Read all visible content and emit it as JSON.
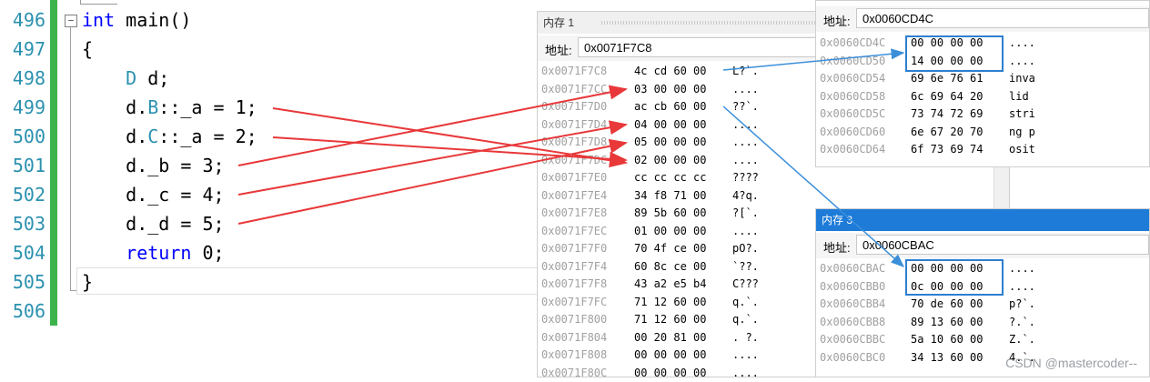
{
  "editor": {
    "lines": [
      {
        "num": "496",
        "tokens": [
          {
            "t": "int",
            "c": "kw"
          },
          {
            "t": " main()",
            "c": ""
          }
        ]
      },
      {
        "num": "497",
        "tokens": [
          {
            "t": "{",
            "c": ""
          }
        ]
      },
      {
        "num": "498",
        "tokens": [
          {
            "t": "    D",
            "c": "ty"
          },
          {
            "t": " d;",
            "c": ""
          }
        ]
      },
      {
        "num": "499",
        "tokens": [
          {
            "t": "    d.",
            "c": ""
          },
          {
            "t": "B",
            "c": "ty"
          },
          {
            "t": "::_a = 1;",
            "c": ""
          }
        ]
      },
      {
        "num": "500",
        "tokens": [
          {
            "t": "    d.",
            "c": ""
          },
          {
            "t": "C",
            "c": "ty"
          },
          {
            "t": "::_a = 2;",
            "c": ""
          }
        ]
      },
      {
        "num": "501",
        "tokens": [
          {
            "t": "    d._b = 3;",
            "c": ""
          }
        ]
      },
      {
        "num": "502",
        "tokens": [
          {
            "t": "    d._c = 4;",
            "c": ""
          }
        ]
      },
      {
        "num": "503",
        "tokens": [
          {
            "t": "    d._d = 5;",
            "c": ""
          }
        ]
      },
      {
        "num": "504",
        "tokens": [
          {
            "t": "    ",
            "c": ""
          },
          {
            "t": "return",
            "c": "kw"
          },
          {
            "t": " 0;",
            "c": ""
          }
        ]
      },
      {
        "num": "505",
        "tokens": [
          {
            "t": "}",
            "c": ""
          }
        ]
      },
      {
        "num": "506",
        "tokens": []
      }
    ],
    "fold_glyph": "−"
  },
  "mem1": {
    "title": "内存 1",
    "addr_label": "地址:",
    "addr_value": "0x0071F7C8",
    "rows": [
      {
        "addr": "0x0071F7C8",
        "bytes": "4c cd 60 00",
        "ascii": "L?`."
      },
      {
        "addr": "0x0071F7CC",
        "bytes": "03 00 00 00",
        "ascii": "...."
      },
      {
        "addr": "0x0071F7D0",
        "bytes": "ac cb 60 00",
        "ascii": "??`."
      },
      {
        "addr": "0x0071F7D4",
        "bytes": "04 00 00 00",
        "ascii": "...."
      },
      {
        "addr": "0x0071F7D8",
        "bytes": "05 00 00 00",
        "ascii": "...."
      },
      {
        "addr": "0x0071F7DC",
        "bytes": "02 00 00 00",
        "ascii": "...."
      },
      {
        "addr": "0x0071F7E0",
        "bytes": "cc cc cc cc",
        "ascii": "????"
      },
      {
        "addr": "0x0071F7E4",
        "bytes": "34 f8 71 00",
        "ascii": "4?q."
      },
      {
        "addr": "0x0071F7E8",
        "bytes": "89 5b 60 00",
        "ascii": "?[`."
      },
      {
        "addr": "0x0071F7EC",
        "bytes": "01 00 00 00",
        "ascii": "...."
      },
      {
        "addr": "0x0071F7F0",
        "bytes": "70 4f ce 00",
        "ascii": "pO?."
      },
      {
        "addr": "0x0071F7F4",
        "bytes": "60 8c ce 00",
        "ascii": "`??."
      },
      {
        "addr": "0x0071F7F8",
        "bytes": "43 a2 e5 b4",
        "ascii": "C???"
      },
      {
        "addr": "0x0071F7FC",
        "bytes": "71 12 60 00",
        "ascii": "q.`."
      },
      {
        "addr": "0x0071F800",
        "bytes": "71 12 60 00",
        "ascii": "q.`."
      },
      {
        "addr": "0x0071F804",
        "bytes": "00 20 81 00",
        "ascii": ". ?."
      },
      {
        "addr": "0x0071F808",
        "bytes": "00 00 00 00",
        "ascii": "...."
      },
      {
        "addr": "0x0071F80C",
        "bytes": "00 00 00 00",
        "ascii": "...."
      }
    ]
  },
  "mem2": {
    "addr_label": "地址:",
    "addr_value": "0x0060CD4C",
    "rows": [
      {
        "addr": "0x0060CD4C",
        "bytes": "00 00 00 00",
        "ascii": "...."
      },
      {
        "addr": "0x0060CD50",
        "bytes": "14 00 00 00",
        "ascii": "...."
      },
      {
        "addr": "0x0060CD54",
        "bytes": "69 6e 76 61",
        "ascii": "inva"
      },
      {
        "addr": "0x0060CD58",
        "bytes": "6c 69 64 20",
        "ascii": "lid "
      },
      {
        "addr": "0x0060CD5C",
        "bytes": "73 74 72 69",
        "ascii": "stri"
      },
      {
        "addr": "0x0060CD60",
        "bytes": "6e 67 20 70",
        "ascii": "ng p"
      },
      {
        "addr": "0x0060CD64",
        "bytes": "6f 73 69 74",
        "ascii": "osit"
      }
    ]
  },
  "mem3": {
    "title": "内存 3",
    "addr_label": "地址:",
    "addr_value": "0x0060CBAC",
    "rows": [
      {
        "addr": "0x0060CBAC",
        "bytes": "00 00 00 00",
        "ascii": "...."
      },
      {
        "addr": "0x0060CBB0",
        "bytes": "0c 00 00 00",
        "ascii": "...."
      },
      {
        "addr": "0x0060CBB4",
        "bytes": "70 de 60 00",
        "ascii": "p?`."
      },
      {
        "addr": "0x0060CBB8",
        "bytes": "89 13 60 00",
        "ascii": "?.`."
      },
      {
        "addr": "0x0060CBBC",
        "bytes": "5a 10 60 00",
        "ascii": "Z.`."
      },
      {
        "addr": "0x0060CBC0",
        "bytes": "34 13 60 00",
        "ascii": "4.`."
      }
    ]
  },
  "watermark": "CSDN @mastercoder--",
  "colors": {
    "arrow_red": "#e8383a",
    "arrow_blue": "#3b8fd9",
    "gutter_green": "#3cb44b"
  }
}
